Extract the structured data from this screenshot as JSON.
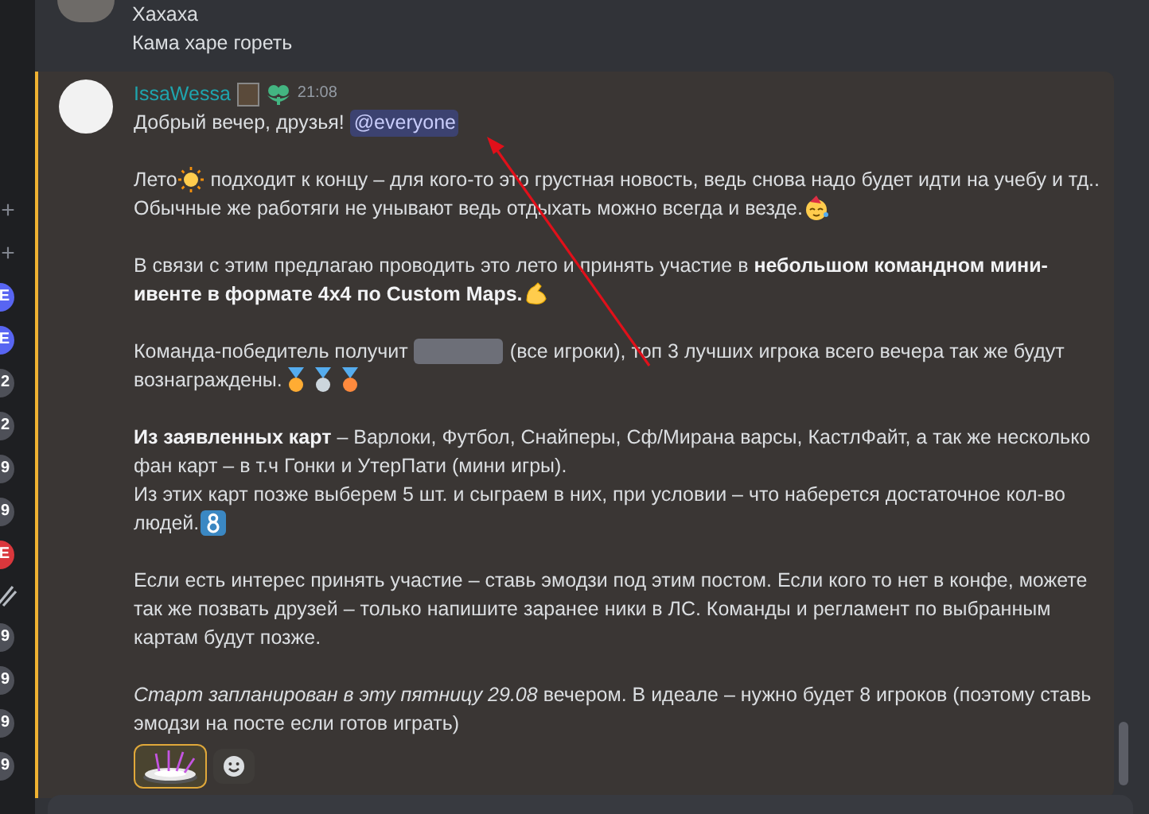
{
  "server_rail": {
    "items": [
      {
        "kind": "add",
        "text": "+"
      },
      {
        "kind": "add",
        "text": "+"
      },
      {
        "kind": "badge",
        "text": "E",
        "color": "#5865f2"
      },
      {
        "kind": "badge",
        "text": "E",
        "color": "#5865f2"
      },
      {
        "kind": "badge",
        "text": "2",
        "color": "#4e5058"
      },
      {
        "kind": "badge",
        "text": "2",
        "color": "#4e5058"
      },
      {
        "kind": "badge",
        "text": "9",
        "color": "#4e5058"
      },
      {
        "kind": "badge",
        "text": "9",
        "color": "#4e5058"
      },
      {
        "kind": "badge",
        "text": "E",
        "color": "#da373c"
      },
      {
        "kind": "slash"
      },
      {
        "kind": "badge",
        "text": "9",
        "color": "#4e5058"
      },
      {
        "kind": "badge",
        "text": "9",
        "color": "#4e5058"
      },
      {
        "kind": "badge",
        "text": "9",
        "color": "#4e5058"
      },
      {
        "kind": "badge",
        "text": "9",
        "color": "#4e5058"
      }
    ]
  },
  "previous_message": {
    "lines": [
      "Хахаха",
      "Кама харе гореть"
    ]
  },
  "message": {
    "highlighted": true,
    "author": "IssaWessa",
    "timestamp": "21:08",
    "paragraphs": [
      [
        [
          {
            "kind": "text",
            "text": "Добрый вечер, друзья!"
          },
          {
            "kind": "mention",
            "text": "@everyone"
          }
        ]
      ],
      [
        [
          {
            "kind": "text",
            "text": "Лето"
          },
          {
            "kind": "emoji"
          },
          {
            "kind": "text",
            "text": "подходит к концу – для кого-то это грустная новость, ведь снова надо будет идти на учебу и тд.."
          }
        ],
        [
          {
            "kind": "text",
            "text": "Обычные же работяги не унывают ведь отдыхать можно всегда и везде."
          },
          {
            "kind": "emoji"
          }
        ]
      ],
      [
        [
          {
            "kind": "text",
            "text": "В связи с этим предлагаю проводить это лето и принять участие в **небольшом командном мини-**"
          }
        ],
        [
          {
            "kind": "text",
            "text": "**ивенте в формате 4x4 по Custom Maps.**"
          },
          {
            "kind": "emoji"
          }
        ]
      ],
      [
        [
          {
            "kind": "text",
            "text": "Команда-победитель получит"
          },
          {
            "kind": "spoiler"
          },
          {
            "kind": "text",
            "text": "(все игроки), топ 3 лучших игрока всего вечера так же будут"
          }
        ],
        [
          {
            "kind": "text",
            "text": "вознаграждены."
          },
          {
            "kind": "emoji"
          },
          {
            "kind": "emoji"
          },
          {
            "kind": "emoji"
          }
        ]
      ],
      [
        [
          {
            "kind": "text",
            "text": "**Из заявленных карт** – Варлоки, Футбол, Снайперы, Сф/Мирана варсы, КастлФайт, а так же несколько"
          }
        ],
        [
          {
            "kind": "text",
            "text": "фан карт – в т.ч Гонки и УтерПати (мини игры)."
          }
        ],
        [
          {
            "kind": "text",
            "text": "Из этих карт позже выберем 5 шт. и сыграем в них, при условии – что наберется достаточное кол-во"
          }
        ],
        [
          {
            "kind": "text",
            "text": "людей."
          },
          {
            "kind": "emoji"
          }
        ]
      ],
      [
        [
          {
            "kind": "text",
            "text": "Если есть интерес принять участие – ставь эмодзи под этим постом. Если кого то нет в конфе, можете"
          }
        ],
        [
          {
            "kind": "text",
            "text": "так же позвать друзей – только напишите заранее ники в ЛС. Команды и регламент по выбранным"
          }
        ],
        [
          {
            "kind": "text",
            "text": "картам будут позже."
          }
        ]
      ],
      [
        [
          {
            "kind": "text",
            "text": "*Старт запланирован в эту пятницу 29.08* вечером. В идеале – нужно будет 8 игроков (поэтому ставь"
          }
        ],
        [
          {
            "kind": "text",
            "text": "эмодзи на посте если готов играть)"
          }
        ]
      ]
    ],
    "reactions": [
      {
        "selected": true
      }
    ]
  }
}
